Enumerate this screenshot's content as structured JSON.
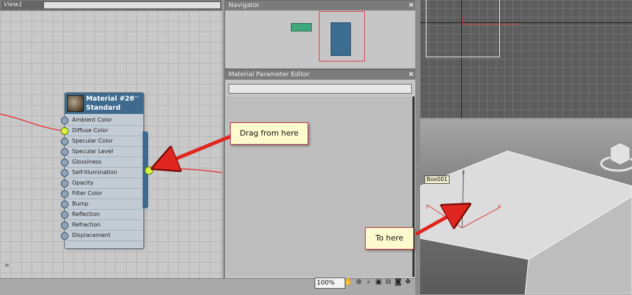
{
  "view": {
    "tab_label": "View1"
  },
  "node": {
    "title": "Material #26",
    "subtitle": "Standard",
    "minimize": "—",
    "slots": [
      {
        "label": "Ambient Color",
        "active": false
      },
      {
        "label": "Diffuse Color",
        "active": true
      },
      {
        "label": "Specular Color",
        "active": false
      },
      {
        "label": "Specular Level",
        "active": false
      },
      {
        "label": "Glossiness",
        "active": false
      },
      {
        "label": "Self-Illumination",
        "active": false
      },
      {
        "label": "Opacity",
        "active": false
      },
      {
        "label": "Filter Color",
        "active": false
      },
      {
        "label": "Bump",
        "active": false
      },
      {
        "label": "Reflection",
        "active": false
      },
      {
        "label": "Refraction",
        "active": false
      },
      {
        "label": "Displacement",
        "active": false
      }
    ]
  },
  "navigator": {
    "title": "Navigator",
    "close": "×"
  },
  "mpe": {
    "title": "Material Parameter Editor",
    "close": "×"
  },
  "viewport": {
    "object_label": "Box001"
  },
  "toolbar": {
    "zoom": "100%"
  },
  "callouts": {
    "drag": "Drag from here",
    "to": "To here"
  },
  "colors": {
    "accent": "#3d6a8e",
    "wire": "#e23b3b",
    "slot_active": "#d9f33a"
  }
}
